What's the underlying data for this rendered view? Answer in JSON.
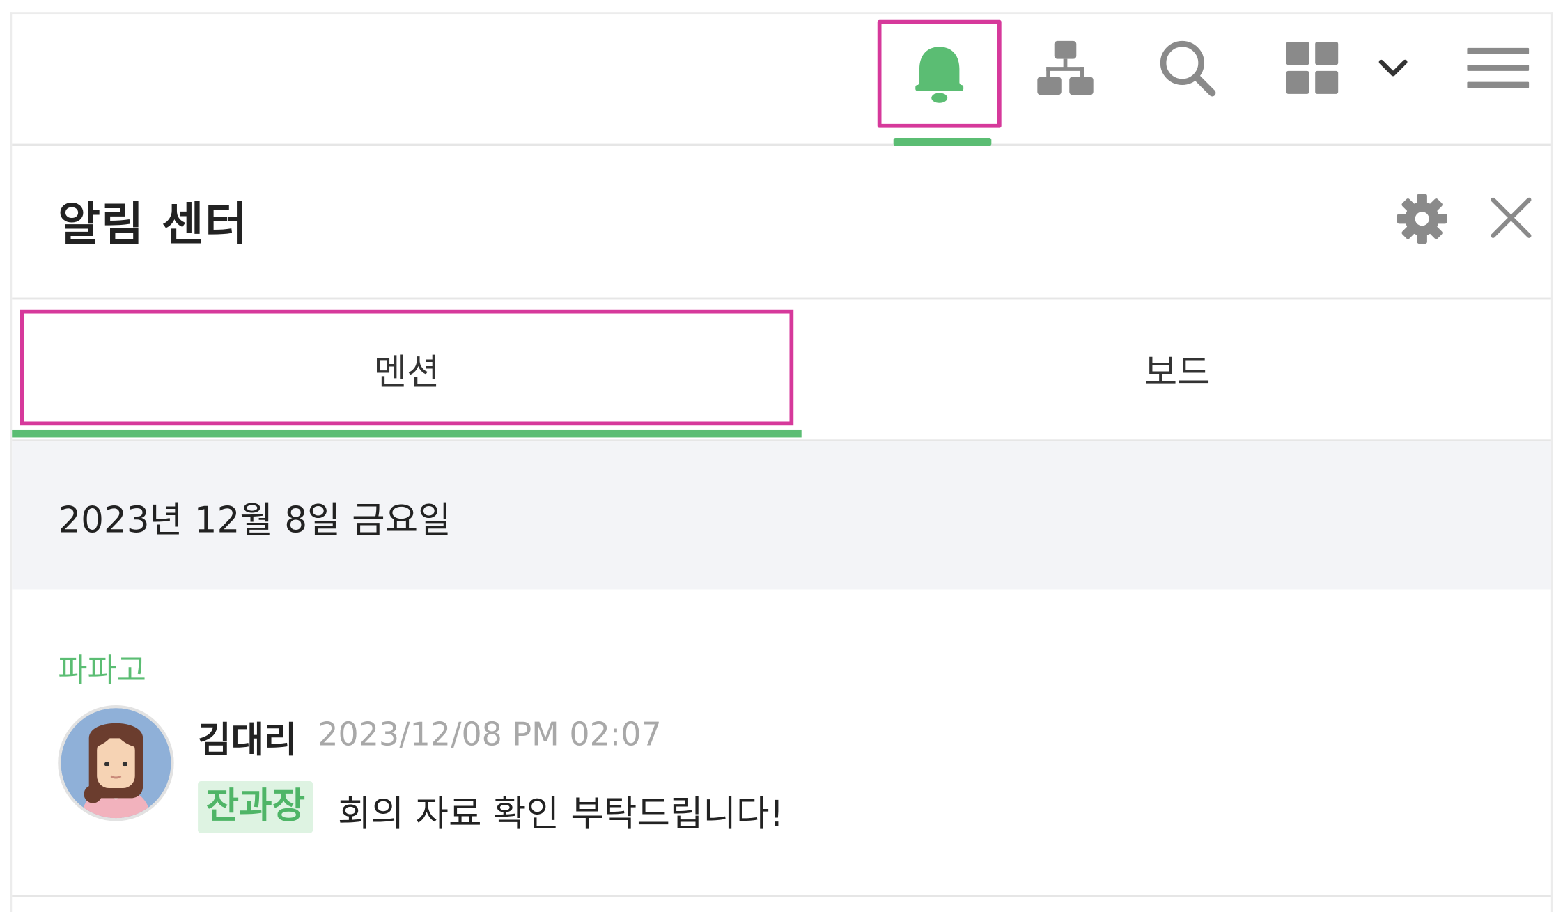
{
  "toolbar": {
    "icons": {
      "bell": "bell-icon",
      "org": "org-chart-icon",
      "search": "search-icon",
      "apps": "apps-grid-icon",
      "apps_dropdown": "chevron-down-icon",
      "menu": "hamburger-menu-icon"
    },
    "accent_color": "#5bbd73",
    "highlight_color": "#d6399b"
  },
  "header": {
    "title": "알림 센터",
    "icons": {
      "settings": "gear-icon",
      "close": "close-icon"
    }
  },
  "tabs": [
    {
      "label": "멘션",
      "active": true
    },
    {
      "label": "보드",
      "active": false
    }
  ],
  "date_group": {
    "label": "2023년 12월 8일 금요일"
  },
  "notifications": [
    {
      "board": "파파고",
      "sender": "김대리",
      "timestamp": "2023/12/08 PM 02:07",
      "mention": "잔과장",
      "message": "회의 자료 확인 부탁드립니다!"
    }
  ]
}
